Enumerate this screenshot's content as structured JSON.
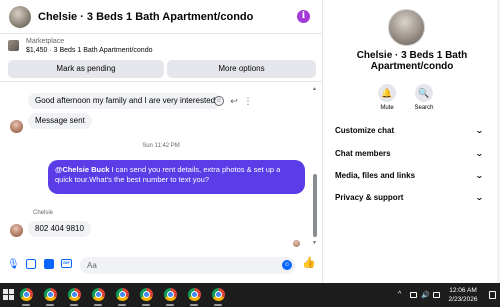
{
  "chat": {
    "title": "Chelsie · 3 Beds 1 Bath Apartment/condo",
    "info_glyph": "i",
    "listing": {
      "kicker": "Marketplace",
      "description": "$1,450 · 3 Beds 1 Bath Apartment/condo",
      "btn_pending": "Mark as pending",
      "btn_more": "More options"
    },
    "messages": {
      "m1": "Good afternoon my family and I are very interested",
      "m2": "Message sent",
      "timestamp": "Sun 11:42 PM",
      "out_mention": "@Chelsie Buck",
      "out_text": "  I can send you rent details, extra photos & set up a quick tour.What's the best number to text you?",
      "sender": "Chelsie",
      "m4": "802 404  9810"
    },
    "composer_placeholder": "Aa"
  },
  "details": {
    "name_line1": "Chelsie · 3 Beds 1 Bath",
    "name_line2": "Apartment/condo",
    "mute_label": "Mute",
    "search_label": "Search",
    "sections": [
      "Customize chat",
      "Chat members",
      "Media, files and links",
      "Privacy & support"
    ]
  },
  "taskbar": {
    "tray_chevron": "^",
    "clock_time": "12:06 AM",
    "clock_date": "2/23/2026"
  },
  "icons": {
    "chat_header_avatar": "profile-photo",
    "info": "info-icon",
    "mute": "bell-icon",
    "search": "magnifier-icon",
    "composer": [
      "mic-icon",
      "image-icon",
      "sticker-icon",
      "gif-icon",
      "emoji-icon",
      "thumbs-up-icon"
    ]
  },
  "colors": {
    "accent_blue": "#0866ff",
    "outgoing_bubble": "#5b3de8",
    "info_purple": "#a33ad8",
    "taskbar": "#1d1d1d"
  }
}
